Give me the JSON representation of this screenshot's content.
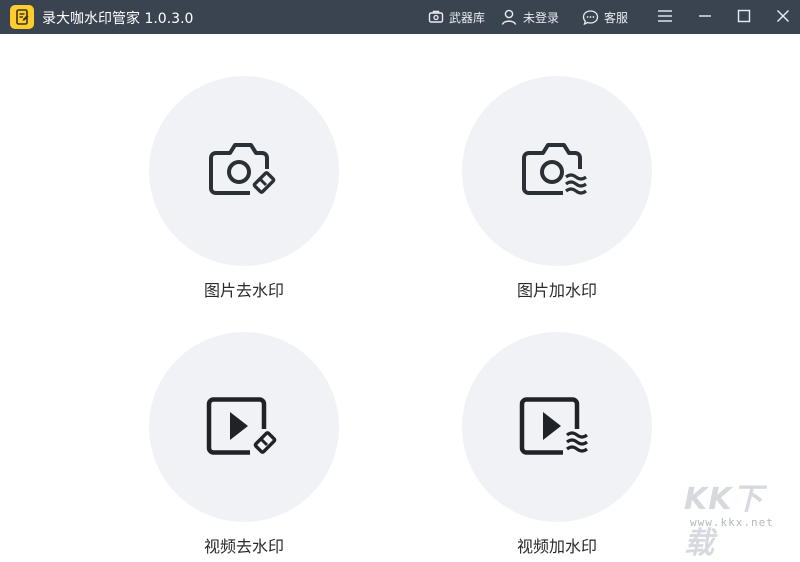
{
  "app": {
    "title": "录大咖水印管家  1.0.3.0",
    "logo": "app-logo-notebook"
  },
  "toolbar": {
    "arsenal_label": "武器库",
    "login_label": "未登录",
    "support_label": "客服"
  },
  "tiles": [
    {
      "label": "图片去水印",
      "icon": "camera-eraser-icon"
    },
    {
      "label": "图片加水印",
      "icon": "camera-wave-icon"
    },
    {
      "label": "视频去水印",
      "icon": "video-eraser-icon"
    },
    {
      "label": "视频加水印",
      "icon": "video-wave-icon"
    }
  ],
  "watermark": {
    "brand": "KK下载",
    "url": "www.kkx.net"
  },
  "colors": {
    "titlebar": "#3a4450",
    "tile_bg": "#f0f2f6",
    "logo": "#ffcc2e",
    "icon": "#2b2f36"
  }
}
